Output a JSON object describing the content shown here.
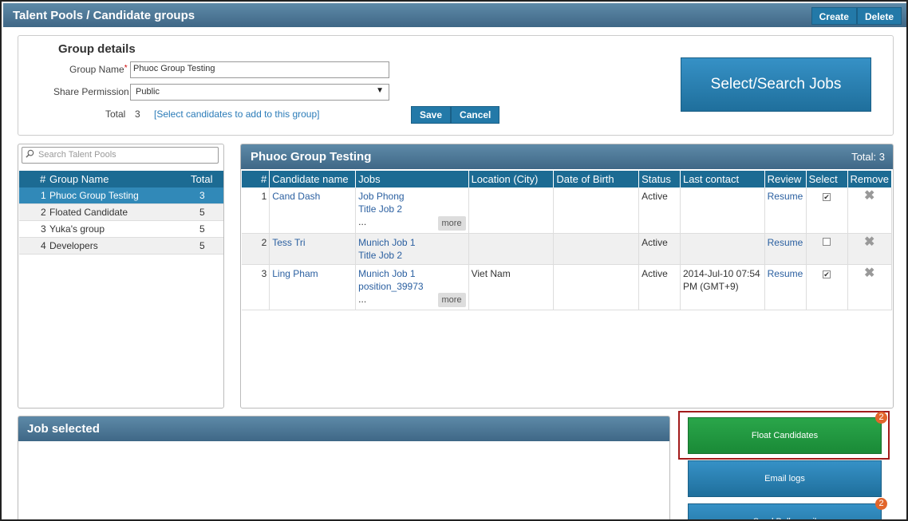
{
  "topbar": {
    "title": "Talent Pools / Candidate groups",
    "create_label": "Create",
    "delete_label": "Delete"
  },
  "group_details": {
    "heading": "Group details",
    "name_label": "Group Name",
    "required_mark": "*",
    "name_value": "Phuoc Group Testing",
    "share_label": "Share Permission",
    "share_value": "Public",
    "total_label": "Total",
    "total_value": "3",
    "select_link": "[Select candidates to add to this group]",
    "save_label": "Save",
    "cancel_label": "Cancel",
    "select_jobs_label": "Select/Search Jobs"
  },
  "pools": {
    "search_placeholder": "Search Talent Pools",
    "header": {
      "num": "#",
      "name": "Group Name",
      "total": "Total"
    },
    "items": [
      {
        "num": "1",
        "name": "Phuoc Group Testing",
        "total": "3"
      },
      {
        "num": "2",
        "name": "Floated Candidate",
        "total": "5"
      },
      {
        "num": "3",
        "name": "Yuka's group",
        "total": "5"
      },
      {
        "num": "4",
        "name": "Developers",
        "total": "5"
      }
    ]
  },
  "candidates": {
    "title": "Phuoc Group Testing",
    "total_text": "Total: 3",
    "columns": [
      "#",
      "Candidate name",
      "Jobs",
      "Location (City)",
      "Date of Birth",
      "Status",
      "Last contact",
      "Review",
      "Select",
      "Remove"
    ],
    "more_label": "more",
    "ellipsis": "...",
    "rows": [
      {
        "num": "1",
        "name": "Cand Dash",
        "job1": "Job Phong",
        "job2": "Title Job 2",
        "location": "",
        "dob": "",
        "status": "Active",
        "last_contact": "",
        "review": "Resume",
        "selected": true
      },
      {
        "num": "2",
        "name": "Tess Tri",
        "job1": "Munich Job 1",
        "job2": "Title Job 2",
        "location": "",
        "dob": "",
        "status": "Active",
        "last_contact": "",
        "review": "Resume",
        "selected": false
      },
      {
        "num": "3",
        "name": "Ling Pham",
        "job1": "Munich Job 1",
        "job2": "position_39973",
        "location": "Viet Nam",
        "dob": "",
        "status": "Active",
        "last_contact": "2014-Jul-10 07:54 PM (GMT+9)",
        "review": "Resume",
        "selected": true
      }
    ]
  },
  "job_selected": {
    "title": "Job selected"
  },
  "actions": {
    "float_label": "Float Candidates",
    "float_badge": "2",
    "email_logs_label": "Email logs",
    "bulk_label": "Send Bulk email",
    "bulk_badge": "2"
  },
  "colors": {
    "header_blue": "#1c6b93",
    "button_blue": "#2379a8",
    "green": "#1a8a37",
    "badge": "#e2652b",
    "highlight": "#a31b1b"
  }
}
